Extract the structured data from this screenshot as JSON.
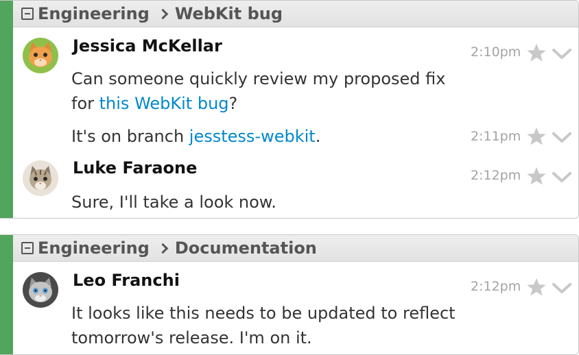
{
  "blocks": [
    {
      "stream": "Engineering",
      "topic": "WebKit bug",
      "stream_color": "#52a55c",
      "messages": [
        {
          "sender": "Jessica McKellar",
          "avatar_icon": "orange-kitten-avatar",
          "time": "2:10pm",
          "text_before": "Can someone quickly review my proposed fix for ",
          "link": "this WebKit bug",
          "text_after": "?"
        },
        {
          "time": "2:11pm",
          "text_before": "It's on branch ",
          "link": "jesstess-webkit",
          "text_after": "."
        },
        {
          "sender": "Luke Faraone",
          "avatar_icon": "tabby-kitten-avatar",
          "time": "2:12pm",
          "text": "Sure, I'll take a look now."
        }
      ]
    },
    {
      "stream": "Engineering",
      "topic": "Documentation",
      "stream_color": "#52a55c",
      "messages": [
        {
          "sender": "Leo Franchi",
          "avatar_icon": "grey-kitten-avatar",
          "time": "2:12pm",
          "text": "It looks like this needs to be updated to reflect tomorrow's release. I'm on it."
        }
      ]
    }
  ],
  "icons": {
    "star": "star-icon",
    "menu": "chevron-down-icon",
    "collapse": "collapse-icon",
    "separator": "chevron-right-icon"
  },
  "colors": {
    "link": "#0088cc",
    "timestamp": "#a3a3a3",
    "action_icon": "#c8c8c8"
  }
}
